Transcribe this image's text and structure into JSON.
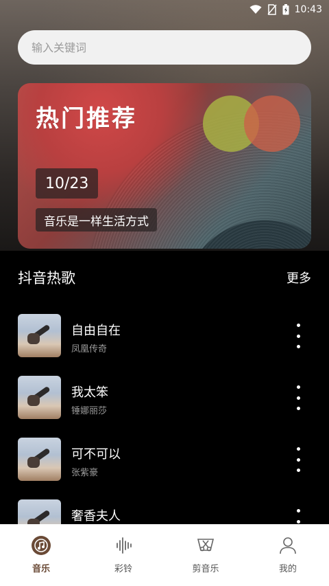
{
  "status_bar": {
    "time": "10:43"
  },
  "search": {
    "placeholder": "输入关键词"
  },
  "banner": {
    "title": "热门推荐",
    "date": "10/23",
    "slogan": "音乐是一样生活方式"
  },
  "section": {
    "title": "抖音热歌",
    "more_label": "更多"
  },
  "songs": [
    {
      "name": "自由自在",
      "artist": "凤凰传奇"
    },
    {
      "name": "我太笨",
      "artist": "锤娜丽莎"
    },
    {
      "name": "可不可以",
      "artist": "张紫豪"
    },
    {
      "name": "奢香夫人",
      "artist": ""
    }
  ],
  "tabs": [
    {
      "label": "音乐",
      "icon": "music-disc-icon",
      "active": true
    },
    {
      "label": "彩铃",
      "icon": "soundwave-icon",
      "active": false
    },
    {
      "label": "剪音乐",
      "icon": "scissors-icon",
      "active": false
    },
    {
      "label": "我的",
      "icon": "user-icon",
      "active": false
    }
  ],
  "colors": {
    "accent": "#6a4a36",
    "tab_bg": "#ffffff",
    "list_bg": "#000000"
  }
}
